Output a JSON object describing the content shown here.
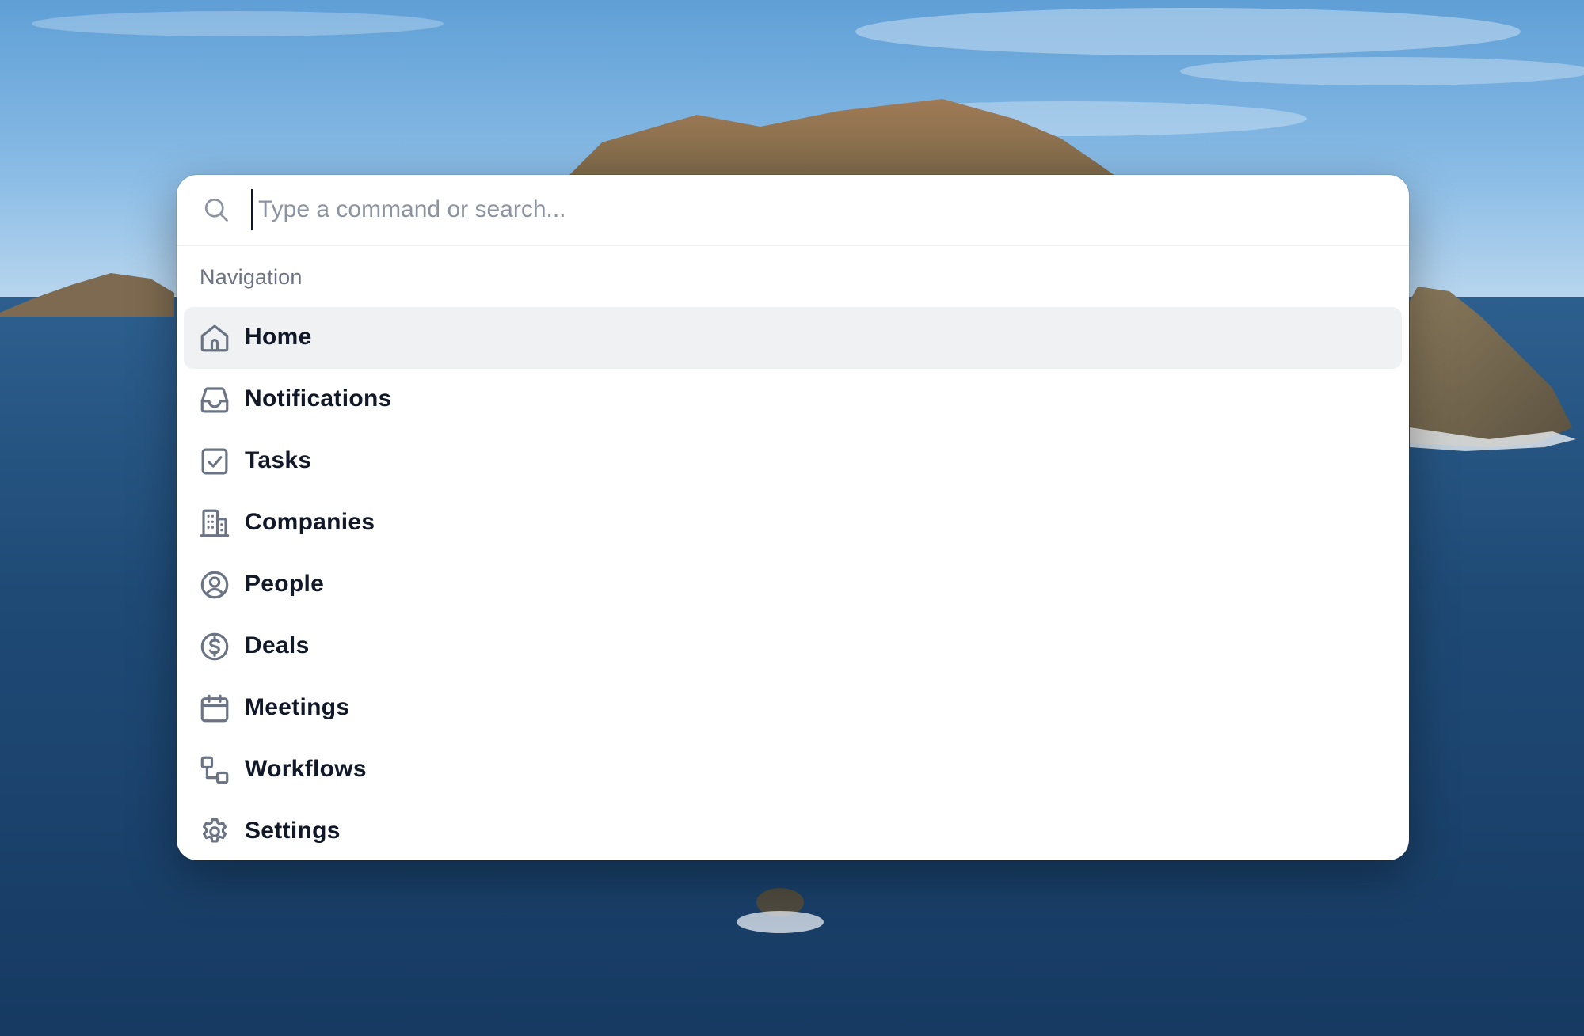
{
  "search": {
    "placeholder": "Type a command or search...",
    "value": ""
  },
  "navigation": {
    "section_label": "Navigation",
    "items": [
      {
        "label": "Home",
        "icon": "home-icon",
        "active": true
      },
      {
        "label": "Notifications",
        "icon": "inbox-icon",
        "active": false
      },
      {
        "label": "Tasks",
        "icon": "checkbox-icon",
        "active": false
      },
      {
        "label": "Companies",
        "icon": "building-icon",
        "active": false
      },
      {
        "label": "People",
        "icon": "user-circle-icon",
        "active": false
      },
      {
        "label": "Deals",
        "icon": "dollar-circle-icon",
        "active": false
      },
      {
        "label": "Meetings",
        "icon": "calendar-icon",
        "active": false
      },
      {
        "label": "Workflows",
        "icon": "workflow-icon",
        "active": false
      },
      {
        "label": "Settings",
        "icon": "gear-icon",
        "active": false
      }
    ]
  },
  "colors": {
    "active_row_bg": "#f0f1f3",
    "icon_stroke": "#6b7484",
    "label_text": "#111827",
    "section_text": "#6b7280",
    "placeholder_text": "#8b93a1"
  }
}
